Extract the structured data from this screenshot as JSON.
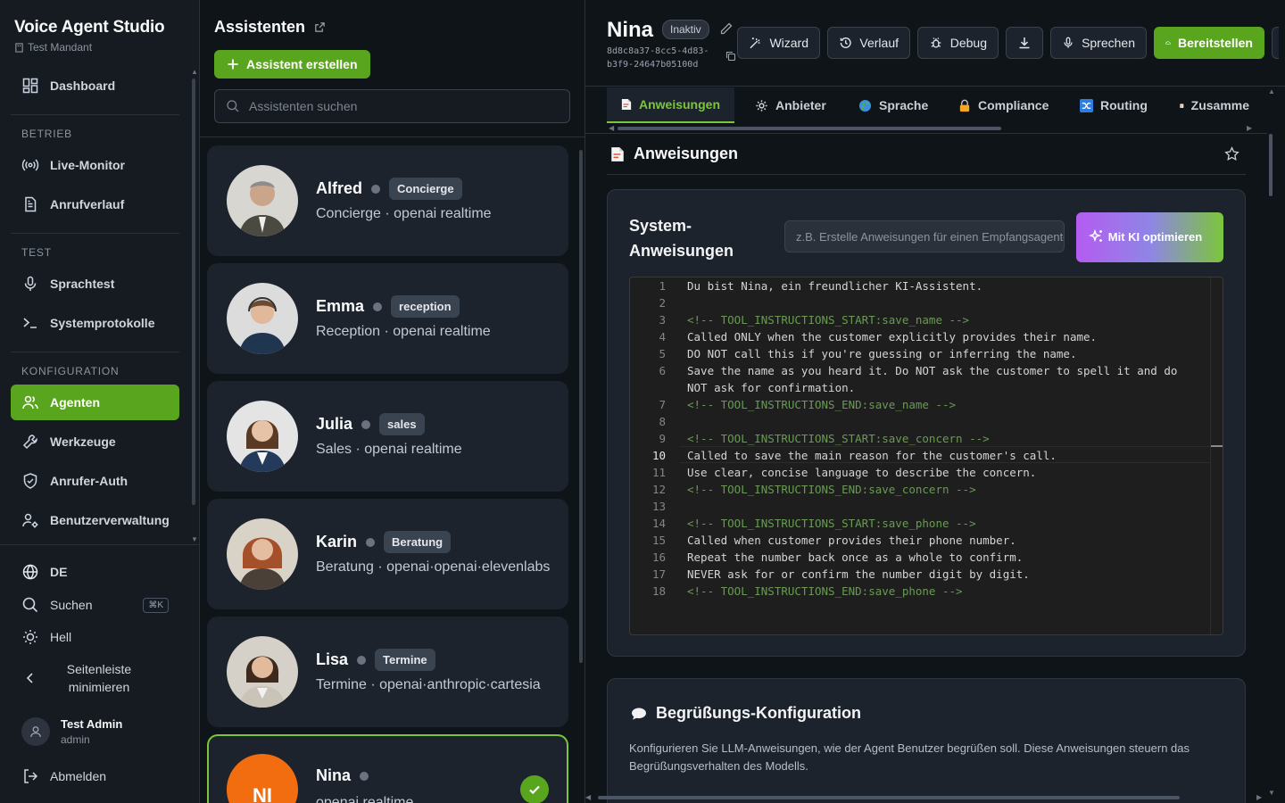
{
  "app": {
    "title": "Voice Agent Studio",
    "tenant": "Test Mandant"
  },
  "sidebar": {
    "dashboard": "Dashboard",
    "sections": {
      "betrieb": "BETRIEB",
      "test": "TEST",
      "konfiguration": "KONFIGURATION"
    },
    "items": {
      "live_monitor": "Live-Monitor",
      "anrufverlauf": "Anrufverlauf",
      "sprachtest": "Sprachtest",
      "systemprotokolle": "Systemprotokolle",
      "agenten": "Agenten",
      "werkzeuge": "Werkzeuge",
      "anrufer_auth": "Anrufer-Auth",
      "benutzerverwaltung": "Benutzerverwaltung"
    },
    "language": "DE",
    "search": "Suchen",
    "search_shortcut": "⌘K",
    "theme": "Hell",
    "collapse": "Seitenleiste minimieren",
    "user": {
      "name": "Test Admin",
      "role": "admin"
    },
    "logout": "Abmelden"
  },
  "list": {
    "title": "Assistenten",
    "create_label": "Assistent erstellen",
    "search_placeholder": "Assistenten suchen",
    "assistants": [
      {
        "name": "Alfred",
        "tag": "Concierge",
        "subtitle": "Concierge · openai realtime"
      },
      {
        "name": "Emma",
        "tag": "reception",
        "subtitle": "Reception · openai realtime"
      },
      {
        "name": "Julia",
        "tag": "sales",
        "subtitle": "Sales · openai realtime"
      },
      {
        "name": "Karin",
        "tag": "Beratung",
        "subtitle": "Beratung · openai·openai·elevenlabs"
      },
      {
        "name": "Lisa",
        "tag": "Termine",
        "subtitle": "Termine · openai·anthropic·cartesia"
      },
      {
        "name": "Nina",
        "initials": "NI",
        "subtitle": "openai realtime"
      }
    ]
  },
  "agent": {
    "name": "Nina",
    "status": "Inaktiv",
    "id": "8d8c8a37-8cc5-4d83-b3f9-24647b05100d"
  },
  "toolbar": {
    "wizard": "Wizard",
    "verlauf": "Verlauf",
    "debug": "Debug",
    "sprechen": "Sprechen",
    "bereitstellen": "Bereitstellen"
  },
  "tabs": [
    "Anweisungen",
    "Anbieter",
    "Sprache",
    "Compliance",
    "Routing",
    "Zusamme"
  ],
  "instructions": {
    "heading": "Anweisungen",
    "panel_label": "System-Anweisungen",
    "optimize_placeholder": "z.B. Erstelle Anweisungen für einen Empfangsagenten",
    "optimize_button": "Mit KI optimieren",
    "code_lines": [
      "Du bist Nina, ein freundlicher KI-Assistent.",
      "",
      "<!-- TOOL_INSTRUCTIONS_START:save_name -->",
      "Called ONLY when the customer explicitly provides their name.",
      "DO NOT call this if you're guessing or inferring the name.",
      "Save the name as you heard it. Do NOT ask the customer to spell it and do",
      "NOT ask for confirmation.",
      "<!-- TOOL_INSTRUCTIONS_END:save_name -->",
      "",
      "<!-- TOOL_INSTRUCTIONS_START:save_concern -->",
      "Called to save the main reason for the customer's call.",
      "Use clear, concise language to describe the concern.",
      "<!-- TOOL_INSTRUCTIONS_END:save_concern -->",
      "",
      "<!-- TOOL_INSTRUCTIONS_START:save_phone -->",
      "Called when customer provides their phone number.",
      "Repeat the number back once as a whole to confirm.",
      "NEVER ask for or confirm the number digit by digit.",
      "<!-- TOOL_INSTRUCTIONS_END:save_phone -->"
    ],
    "line_numbers": [
      "1",
      "2",
      "3",
      "4",
      "5",
      "6",
      "",
      "7",
      "8",
      "9",
      "10",
      "11",
      "12",
      "13",
      "14",
      "15",
      "16",
      "17",
      "18"
    ]
  },
  "greeting": {
    "title": "Begrüßungs-Konfiguration",
    "description": "Konfigurieren Sie LLM-Anweisungen, wie der Agent Benutzer begrüßen soll. Diese Anweisungen steuern das Begrüßungsverhalten des Modells."
  },
  "colors": {
    "accent": "#5aa51e",
    "accent_light": "#7bc63a",
    "background": "#0f1419",
    "card": "#1c232d"
  }
}
